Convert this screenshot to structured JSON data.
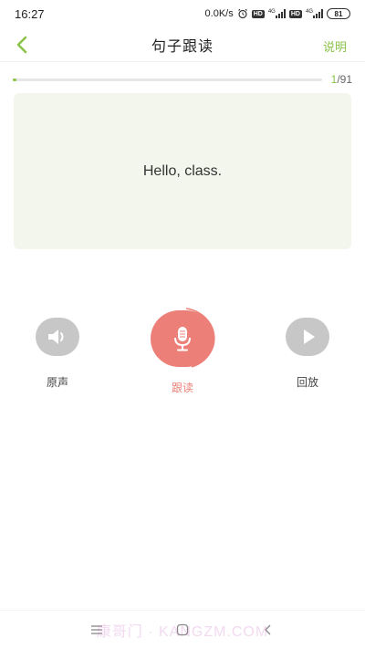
{
  "status_bar": {
    "time": "16:27",
    "net_speed": "0.0K/s",
    "hd_label": "HD",
    "net_type": "4G",
    "battery": "81"
  },
  "nav": {
    "title": "句子跟读",
    "explain_label": "说明"
  },
  "progress": {
    "current": "1",
    "total": "/91",
    "fraction": 0.011
  },
  "sentence": {
    "text": "Hello, class."
  },
  "controls": {
    "original_label": "原声",
    "record_label": "跟读",
    "playback_label": "回放"
  },
  "watermark": {
    "text": "康哥门 · KANGZM.COM"
  },
  "colors": {
    "accent": "#8bc34a",
    "record": "#ec8078",
    "card_bg": "#f3f6ec",
    "button_grey": "#c7c7c7"
  },
  "icons": [
    "back-arrow-icon",
    "speaker-icon",
    "microphone-icon",
    "play-icon",
    "menu-icon",
    "home-icon",
    "back-icon"
  ]
}
